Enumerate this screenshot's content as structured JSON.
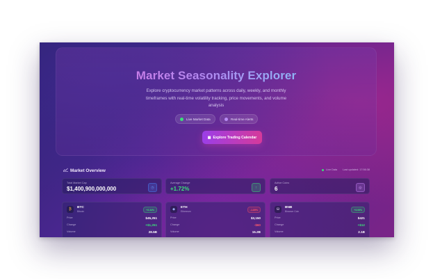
{
  "hero": {
    "title": "Market Seasonality Explorer",
    "description": "Explore cryptocurrency market patterns across daily, weekly, and monthly timeframes with real-time volatility tracking, price movements, and volume analysis",
    "pills": [
      {
        "label": "Live Market Data",
        "dot_color": "#3be07a"
      },
      {
        "label": "Real-time Alerts",
        "dot_color": "#b98cf5"
      }
    ],
    "cta_label": "Explore Trading Calendar",
    "cta_icon": "calendar-icon"
  },
  "overview": {
    "title": "Market Overview",
    "title_icon": "chart-icon",
    "status": "Live Data",
    "updated": "Last updated: 17:56:38",
    "stats": [
      {
        "label": "Total Market Cap",
        "value": "$1,400,900,000,000",
        "icon": "clock-icon",
        "color": "#4a7df0"
      },
      {
        "label": "Average Change",
        "value": "+1.72%",
        "icon": "arrow-up-icon",
        "color": "#3be07a"
      },
      {
        "label": "Active Coins",
        "value": "6",
        "icon": "coins-icon",
        "color": "#c07af0"
      }
    ],
    "coins": [
      {
        "symbol": "BTC",
        "name": "Bitcoin",
        "change": "+2.34%",
        "trend": "up",
        "price_label": "Price",
        "price": "$45,251",
        "change_label": "Change",
        "change_value": "+$1,251",
        "volume_label": "Volume",
        "volume": "28.5B"
      },
      {
        "symbol": "ETH",
        "name": "Ethereum",
        "change": "-1.89%",
        "trend": "down",
        "price_label": "Price",
        "price": "$3,150",
        "change_label": "Change",
        "change_value": "-$60",
        "volume_label": "Volume",
        "volume": "15.2B"
      },
      {
        "symbol": "BNB",
        "name": "Binance Coin",
        "change": "+3.06%",
        "trend": "up",
        "price_label": "Price",
        "price": "$421",
        "change_label": "Change",
        "change_value": "+$12",
        "volume_label": "Volume",
        "volume": "2.1B"
      }
    ]
  }
}
